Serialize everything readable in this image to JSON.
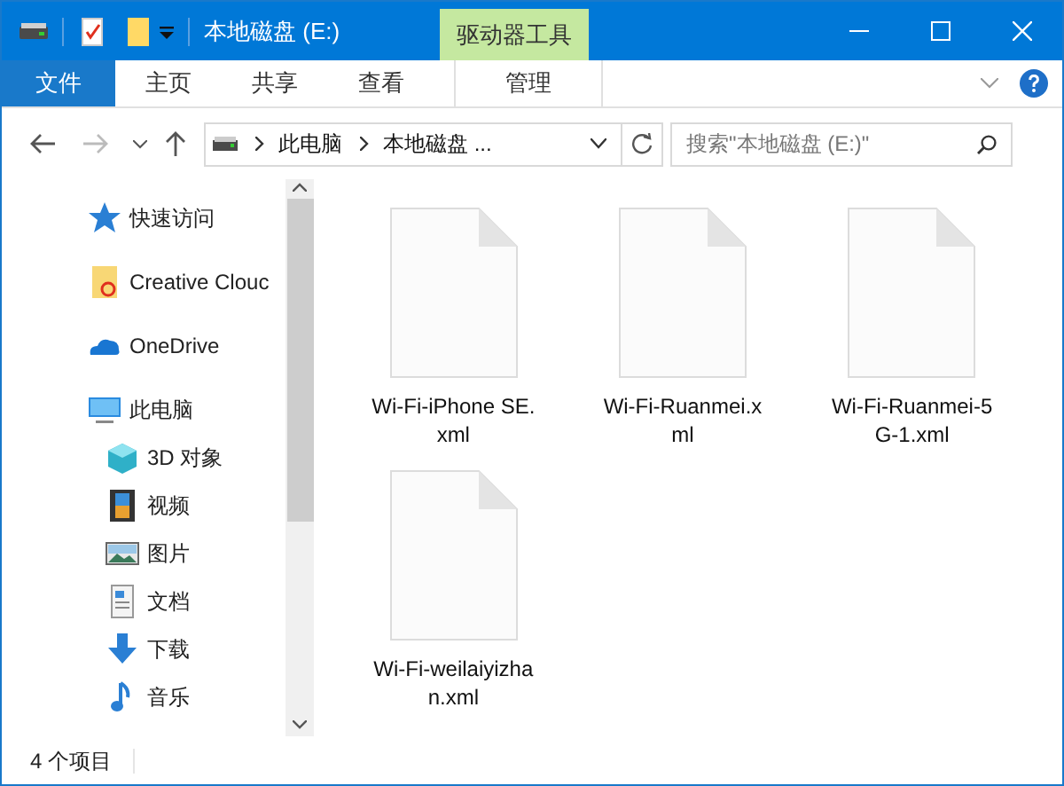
{
  "window": {
    "title": "本地磁盘 (E:)"
  },
  "ribbon": {
    "context_group": "驱动器工具",
    "tabs": [
      {
        "label": "文件",
        "kind": "file"
      },
      {
        "label": "主页",
        "kind": "tab"
      },
      {
        "label": "共享",
        "kind": "tab"
      },
      {
        "label": "查看",
        "kind": "tab"
      },
      {
        "label": "管理",
        "kind": "context"
      }
    ]
  },
  "address_bar": {
    "breadcrumbs": [
      "此电脑",
      "本地磁盘 ..."
    ]
  },
  "search": {
    "placeholder": "搜索\"本地磁盘 (E:)\""
  },
  "sidebar": {
    "items": [
      {
        "label": "快速访问",
        "kind": "star"
      },
      {
        "label": "Creative Clouc",
        "kind": "cc"
      },
      {
        "label": "OneDrive",
        "kind": "cloud"
      },
      {
        "label": "此电脑",
        "kind": "pc",
        "children": [
          {
            "label": "3D 对象",
            "kind": "cube"
          },
          {
            "label": "视频",
            "kind": "film"
          },
          {
            "label": "图片",
            "kind": "picture"
          },
          {
            "label": "文档",
            "kind": "document"
          },
          {
            "label": "下载",
            "kind": "download"
          },
          {
            "label": "音乐",
            "kind": "music"
          }
        ]
      }
    ]
  },
  "files": [
    {
      "name": "Wi-Fi-iPhone SE.xml"
    },
    {
      "name": "Wi-Fi-Ruanmei.xml"
    },
    {
      "name": "Wi-Fi-Ruanmei-5G-1.xml"
    },
    {
      "name": "Wi-Fi-weilaiyizhan.xml"
    }
  ],
  "status_bar": {
    "item_count": "4 个项目"
  }
}
